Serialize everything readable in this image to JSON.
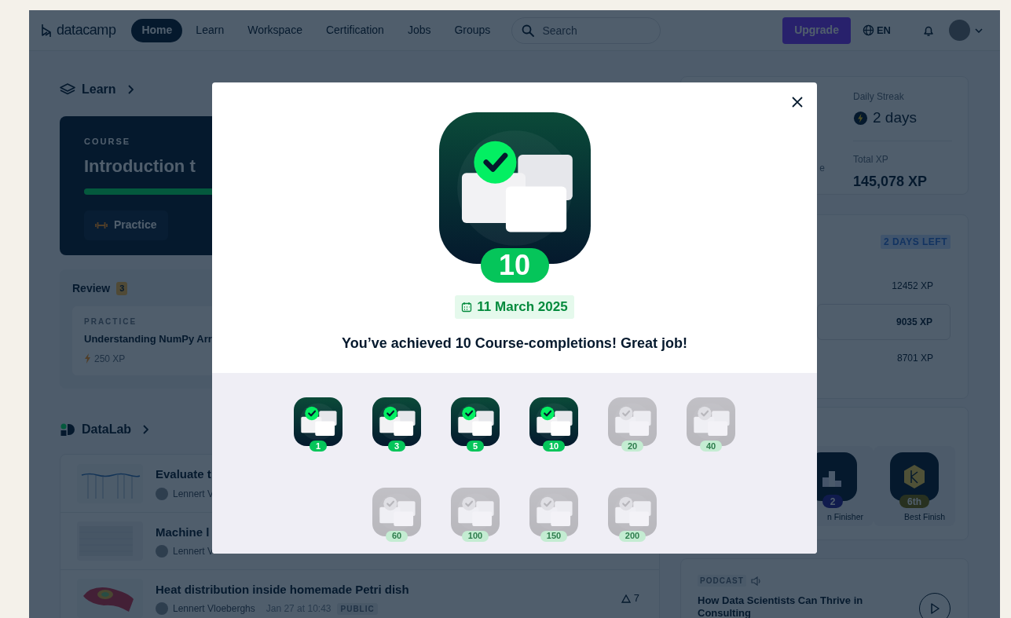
{
  "nav": {
    "logo": "datacamp",
    "tabs": [
      {
        "label": "Home",
        "selected": true
      },
      {
        "label": "Learn",
        "selected": false
      },
      {
        "label": "Workspace",
        "selected": false
      },
      {
        "label": "Certification",
        "selected": false
      },
      {
        "label": "Jobs",
        "selected": false
      },
      {
        "label": "Groups",
        "selected": false
      }
    ],
    "search": {
      "placeholder": "Search"
    },
    "upgrade": "Upgrade",
    "language": "EN"
  },
  "learn": {
    "title": "Learn",
    "course": {
      "eyebrow": "COURSE",
      "title": "Introduction t",
      "level": 0.6,
      "practice": "Practice"
    },
    "review": {
      "title": "Review",
      "count": "3",
      "item": {
        "eyebrow": "PRACTICE",
        "title": "Understanding NumPy Arr",
        "xp": "250 XP"
      }
    }
  },
  "datalab": {
    "title": "DataLab",
    "items": [
      {
        "kind": "line",
        "title": "Evaluate t",
        "author": "Lennert V"
      },
      {
        "kind": "table",
        "title": "Machine l",
        "author": "Lennert V"
      },
      {
        "kind": "heatmap",
        "title": "Heat distribution inside homemade Petri dish",
        "author": "Lennert Vloeberghs",
        "date": "Jan 27 at 10:43",
        "visibility": "PUBLIC",
        "upvotes": "7"
      }
    ]
  },
  "stats": {
    "partial_label": "e",
    "streak_label": "Daily Streak",
    "streak": "2 days",
    "xp_label": "Total XP",
    "xp": "145,078 XP"
  },
  "leaderboard": {
    "badge": "2 DAYS LEFT",
    "rows": [
      {
        "xp": "12452 XP",
        "selected": false
      },
      {
        "xp": "9035 XP",
        "selected": true
      },
      {
        "xp": "8701 XP",
        "selected": false
      }
    ]
  },
  "badges": [
    {
      "kind": "podium",
      "value": "2",
      "label": "n Finisher"
    },
    {
      "kind": "hexagon",
      "value": "6th",
      "label": "Best Finish"
    }
  ],
  "podcast": {
    "eyebrow": "PODCAST",
    "title": "How Data Scientists Can Thrive in Consulting"
  },
  "modal": {
    "count": "10",
    "date": "11 March 2025",
    "message": "You’ve achieved 10 Course-completions! Great job!",
    "milestones": [
      {
        "value": "1",
        "achieved": true
      },
      {
        "value": "3",
        "achieved": true
      },
      {
        "value": "5",
        "achieved": true
      },
      {
        "value": "10",
        "achieved": true
      },
      {
        "value": "20",
        "achieved": false
      },
      {
        "value": "40",
        "achieved": false
      },
      {
        "value": "60",
        "achieved": false
      },
      {
        "value": "100",
        "achieved": false
      },
      {
        "value": "150",
        "achieved": false
      },
      {
        "value": "200",
        "achieved": false
      }
    ]
  }
}
